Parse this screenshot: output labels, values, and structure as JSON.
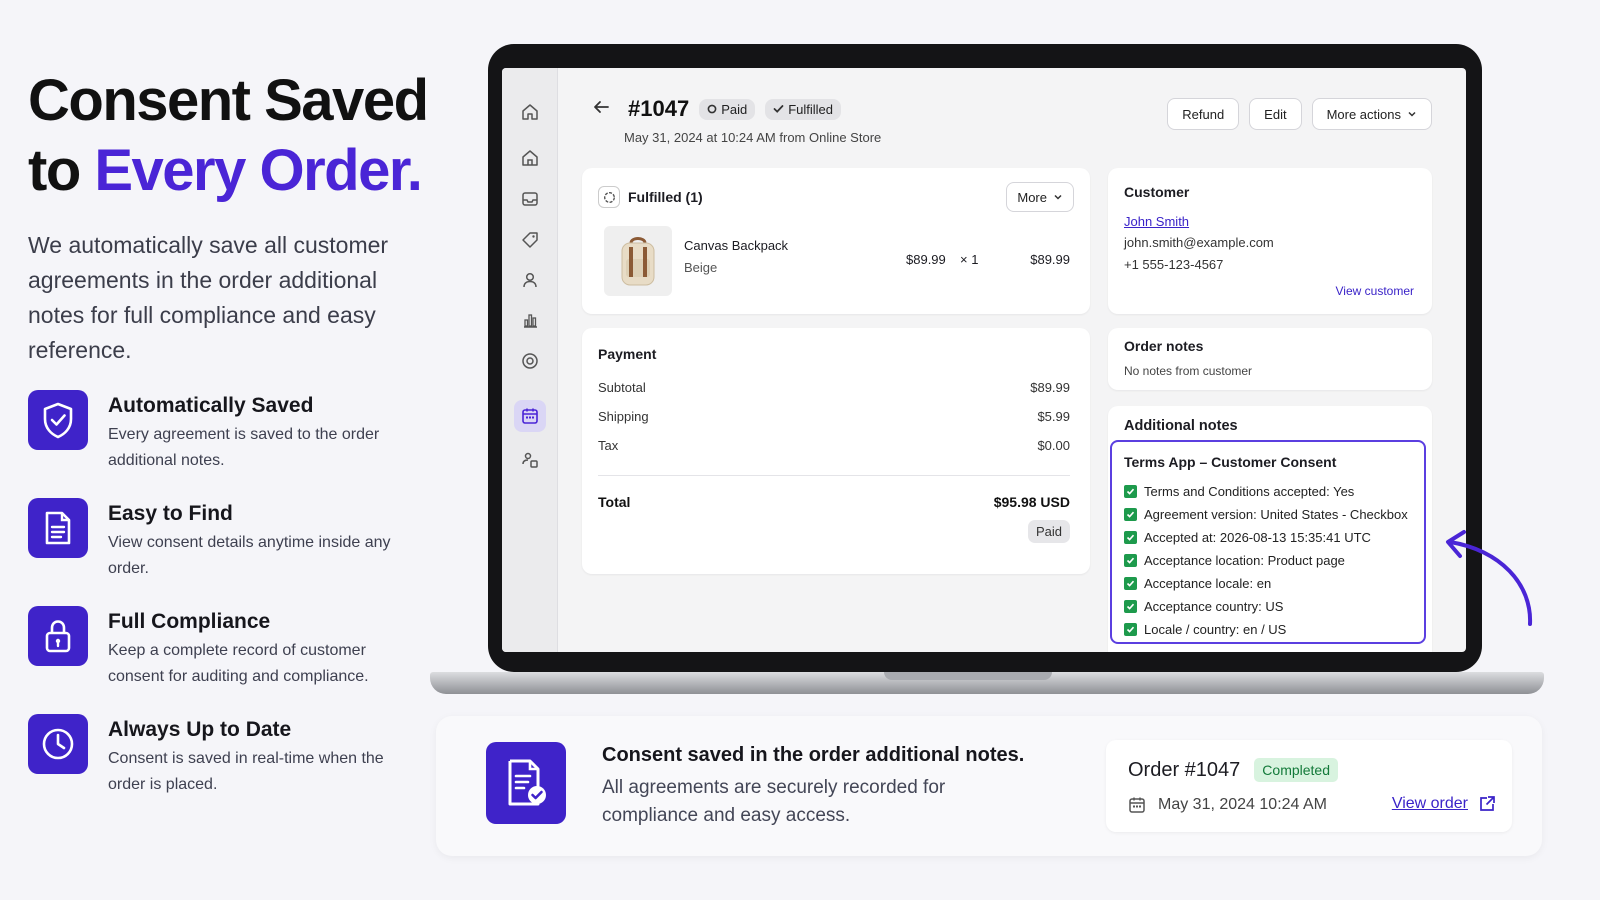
{
  "hero": {
    "title_line1": "Consent Saved",
    "title_line2_prefix": "to ",
    "title_line2_accent": "Every Order.",
    "intro": "We automatically save all customer agreements in the order additional notes for full compliance and easy reference."
  },
  "features": [
    {
      "icon": "shield-check-icon",
      "title": "Automatically Saved",
      "desc": "Every agreement is saved to the order additional notes."
    },
    {
      "icon": "document-icon",
      "title": "Easy to Find",
      "desc": "View consent details anytime inside any order."
    },
    {
      "icon": "lock-icon",
      "title": "Full Compliance",
      "desc": "Keep a complete record of customer consent for auditing and compliance."
    },
    {
      "icon": "clock-icon",
      "title": "Always Up to Date",
      "desc": "Consent is saved in real-time when the order is placed."
    }
  ],
  "order": {
    "number": "#1047",
    "badges": {
      "paid": "Paid",
      "fulfilled": "Fulfilled"
    },
    "date_line": "May 31, 2024 at 10:24 AM from Online Store",
    "actions": {
      "refund": "Refund",
      "edit": "Edit",
      "more_actions": "More actions"
    }
  },
  "fulfilled_card": {
    "title": "Fulfilled (1)",
    "more": "More",
    "item": {
      "name": "Canvas Backpack",
      "variant": "Beige",
      "price": "$89.99",
      "qty": "× 1",
      "total": "$89.99"
    }
  },
  "payment": {
    "title": "Payment",
    "lines": [
      {
        "label": "Subtotal",
        "value": "$89.99"
      },
      {
        "label": "Shipping",
        "value": "$5.99"
      },
      {
        "label": "Tax",
        "value": "$0.00"
      }
    ],
    "total_label": "Total",
    "total_value": "$95.98 USD",
    "status": "Paid"
  },
  "customer": {
    "title": "Customer",
    "name": "John Smith",
    "email": "john.smith@example.com",
    "phone": "+1 555-123-4567",
    "view_link": "View customer"
  },
  "order_notes": {
    "title": "Order notes",
    "text": "No notes from customer"
  },
  "additional_notes": {
    "title": "Additional notes",
    "consent_title": "Terms App – Customer Consent",
    "items": [
      "Terms and Conditions accepted: Yes",
      "Agreement version: United States - Checkbox",
      "Accepted at: 2026-08-13 15:35:41 UTC",
      "Acceptance location: Product page",
      "Acceptance locale: en",
      "Acceptance country: US",
      "Locale / country: en / US"
    ]
  },
  "bottom": {
    "title": "Consent saved in the order additional notes.",
    "desc": "All agreements are securely recorded for compliance and easy access.",
    "order_label": "Order #1047",
    "status": "Completed",
    "date": "May 31, 2024 10:24 AM",
    "view_order": "View order"
  },
  "colors": {
    "accent": "#4a25d6",
    "icon_bg": "#3f23c9",
    "check_green": "#1d9a4c",
    "completed_bg": "#d8f3df",
    "completed_text": "#137a3a"
  }
}
